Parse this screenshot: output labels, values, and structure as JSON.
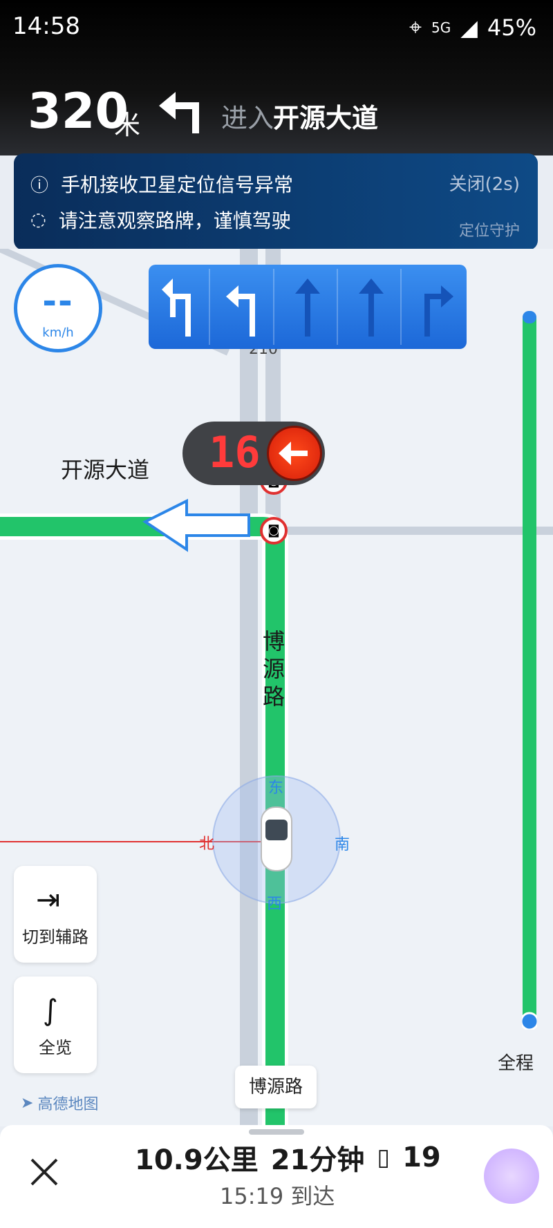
{
  "status_bar": {
    "time": "14:58",
    "battery": "45%",
    "network": "5G"
  },
  "navigation": {
    "distance_value": "320",
    "distance_unit": "米",
    "action_prefix": "进入",
    "road_name": "开源大道",
    "turn_icon": "turn-left-icon"
  },
  "alert": {
    "line1": "手机接收卫星定位信号异常",
    "line2": "请注意观察路牌，谨慎驾驶",
    "close_label": "关闭(2s)",
    "guard_label": "定位守护"
  },
  "speed": {
    "value": "--",
    "unit": "km/h"
  },
  "lanes": [
    "u-turn-left",
    "left",
    "straight",
    "straight",
    "right"
  ],
  "traffic_signal": {
    "countdown": "16",
    "direction_icon": "left-arrow-icon",
    "color": "#e0300f"
  },
  "map": {
    "road_main": "博源路",
    "road_cross": "开源大道",
    "road_number": "210",
    "compass": {
      "east": "东",
      "south": "南",
      "west": "西",
      "north": "北"
    }
  },
  "side_buttons": {
    "switch_label": "切到辅路",
    "overview_label": "全览"
  },
  "route_bar": {
    "label": "全程",
    "color": "#22c46a"
  },
  "road_chip": "博源路",
  "logo": "高德地图",
  "trip": {
    "distance": "10.9公里",
    "duration": "21分钟",
    "traffic_lights": "19",
    "arrival": "15:19 到达"
  },
  "colors": {
    "accent": "#2c86e8",
    "route_green": "#22c46a",
    "signal_red": "#e0300f"
  }
}
